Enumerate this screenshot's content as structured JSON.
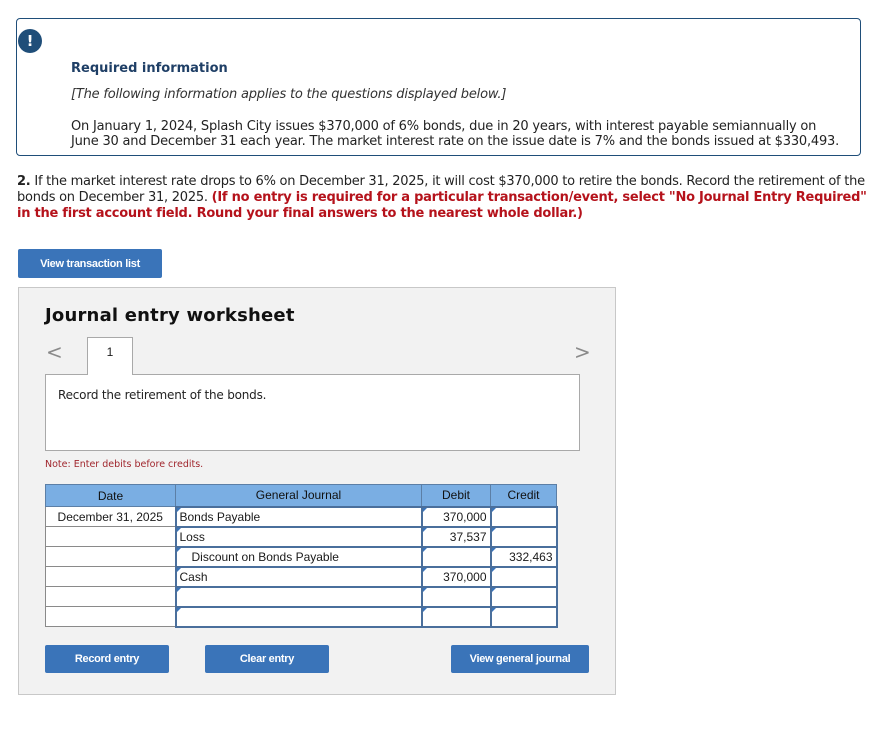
{
  "info": {
    "badge": "!",
    "title": "Required information",
    "subtitle": "[The following information applies to the questions displayed below.]",
    "body": "On January 1, 2024, Splash City issues $370,000 of 6% bonds, due in 20 years, with interest payable semiannually on June 30 and December 31 each year. The market interest rate on the issue date is 7% and the bonds issued at $330,493."
  },
  "question": {
    "number": "2.",
    "text": " If the market interest rate drops to 6% on December 31, 2025, it will cost $370,000 to retire the bonds. Record the retirement of the bonds on December 31, 2025. ",
    "instruction": "(If no entry is required for a particular transaction/event, select \"No Journal Entry Required\" in the first account field. Round your final answers to the nearest whole dollar.)"
  },
  "buttons": {
    "view_transaction_list": "View transaction list",
    "record_entry": "Record entry",
    "clear_entry": "Clear entry",
    "view_general_journal": "View general journal"
  },
  "worksheet": {
    "title": "Journal entry worksheet",
    "prev_icon": "<",
    "next_icon": ">",
    "tab": "1",
    "description": "Record the retirement of the bonds.",
    "note": "Note: Enter debits before credits.",
    "columns": [
      "Date",
      "General Journal",
      "Debit",
      "Credit"
    ],
    "rows": [
      {
        "date": "December 31, 2025",
        "account": "Bonds Payable",
        "debit": "370,000",
        "credit": ""
      },
      {
        "date": "",
        "account": "Loss",
        "debit": "37,537",
        "credit": ""
      },
      {
        "date": "",
        "account": "Discount on Bonds Payable",
        "debit": "",
        "credit": "332,463"
      },
      {
        "date": "",
        "account": "Cash",
        "debit": "370,000",
        "credit": ""
      },
      {
        "date": "",
        "account": "",
        "debit": "",
        "credit": ""
      },
      {
        "date": "",
        "account": "",
        "debit": "",
        "credit": ""
      }
    ]
  }
}
